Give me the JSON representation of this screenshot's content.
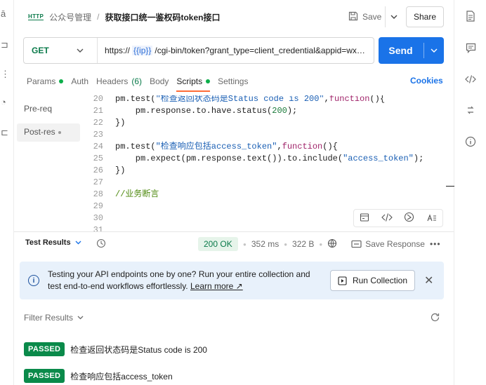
{
  "breadcrumb": {
    "protocol": "HTTP",
    "parent": "公众号管理",
    "separator": "/",
    "current": "获取接口统一鉴权码token接口"
  },
  "header_actions": {
    "save_label": "Save",
    "share_label": "Share"
  },
  "request": {
    "method": "GET",
    "url_prefix": "https://",
    "url_variable": "{{ip}}",
    "url_suffix": "/cgi-bin/token?grant_type=client_credential&appid=wx…",
    "send_label": "Send"
  },
  "tabs": {
    "items": [
      {
        "label": "Params",
        "dot": true,
        "active": false
      },
      {
        "label": "Auth",
        "active": false
      },
      {
        "label": "Headers",
        "count": "(6)",
        "active": false
      },
      {
        "label": "Body",
        "active": false
      },
      {
        "label": "Scripts",
        "dot": true,
        "active": true
      },
      {
        "label": "Settings",
        "active": false
      }
    ],
    "cookies_label": "Cookies"
  },
  "script_sides": {
    "pre": "Pre-req",
    "post": "Post-res"
  },
  "code": {
    "lines": [
      {
        "n": "20",
        "text": "pm.test(\"检查返回状态码是Status code is 200\",function(){"
      },
      {
        "n": "21",
        "text": "    pm.response.to.have.status(200);"
      },
      {
        "n": "22",
        "text": "})"
      },
      {
        "n": "23",
        "text": ""
      },
      {
        "n": "24",
        "text": "pm.test(\"检查响应包括access_token\",function(){"
      },
      {
        "n": "25",
        "text": "    pm.expect(pm.response.text()).to.include(\"access_token\");"
      },
      {
        "n": "26",
        "text": "})"
      },
      {
        "n": "27",
        "text": ""
      },
      {
        "n": "28",
        "text": "//业务断言"
      },
      {
        "n": "29",
        "text": ""
      },
      {
        "n": "30",
        "text": ""
      },
      {
        "n": "31",
        "text": ""
      }
    ]
  },
  "response": {
    "test_results_label": "Test Results",
    "status": "200 OK",
    "time": "352 ms",
    "size": "322 B",
    "save_response_label": "Save Response"
  },
  "banner": {
    "line1": "Testing your API endpoints one by one? Run your entire collection and",
    "line2": "test end-to-end workflows effortlessly.",
    "learn_more": "Learn more ↗",
    "run_collection_label": "Run Collection"
  },
  "filter_label": "Filter Results",
  "results": [
    {
      "badge": "PASSED",
      "name": "检查返回状态码是Status code is 200"
    },
    {
      "badge": "PASSED",
      "name": "检查响应包括access_token"
    }
  ],
  "colors": {
    "accent_blue": "#1a73e8",
    "success_green": "#0a8a4a",
    "tab_underline": "#ff6c37",
    "banner_bg": "#e8f1fb"
  },
  "icons": [
    "document-icon",
    "comment-icon",
    "code-icon",
    "arrows-icon",
    "info-icon",
    "save-icon",
    "history-icon",
    "globe-icon",
    "refresh-icon"
  ]
}
